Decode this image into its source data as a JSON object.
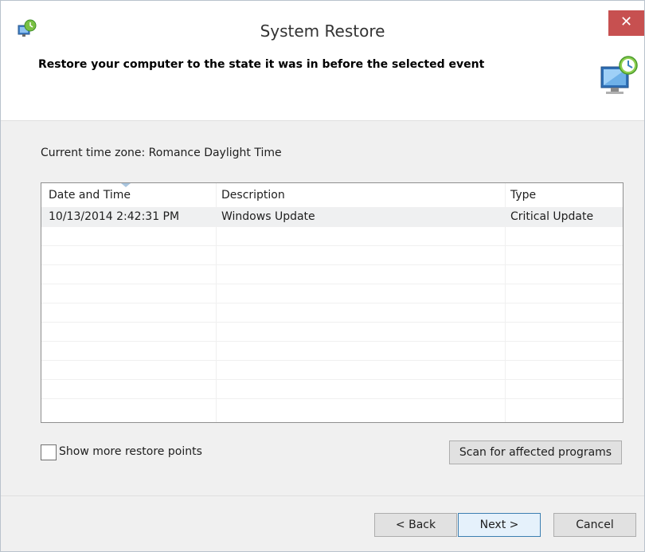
{
  "window": {
    "title": "System Restore",
    "close_glyph": "✕"
  },
  "header": {
    "title": "Restore your computer to the state it was in before the selected event"
  },
  "timezone": {
    "label": "Current time zone: Romance Daylight Time"
  },
  "table": {
    "columns": [
      "Date and Time",
      "Description",
      "Type"
    ],
    "sorted_column": "Date and Time",
    "rows": [
      {
        "date": "10/13/2014 2:42:31 PM",
        "description": "Windows Update",
        "type": "Critical Update"
      }
    ]
  },
  "options": {
    "show_more_label": "Show more restore points",
    "show_more_checked": false
  },
  "buttons": {
    "scan": "Scan for affected programs",
    "back": "< Back",
    "next": "Next >",
    "cancel": "Cancel"
  },
  "colors": {
    "close_button": "#c75050",
    "focus_border": "#3c7fb1",
    "selected_row": "#eff0f1"
  }
}
